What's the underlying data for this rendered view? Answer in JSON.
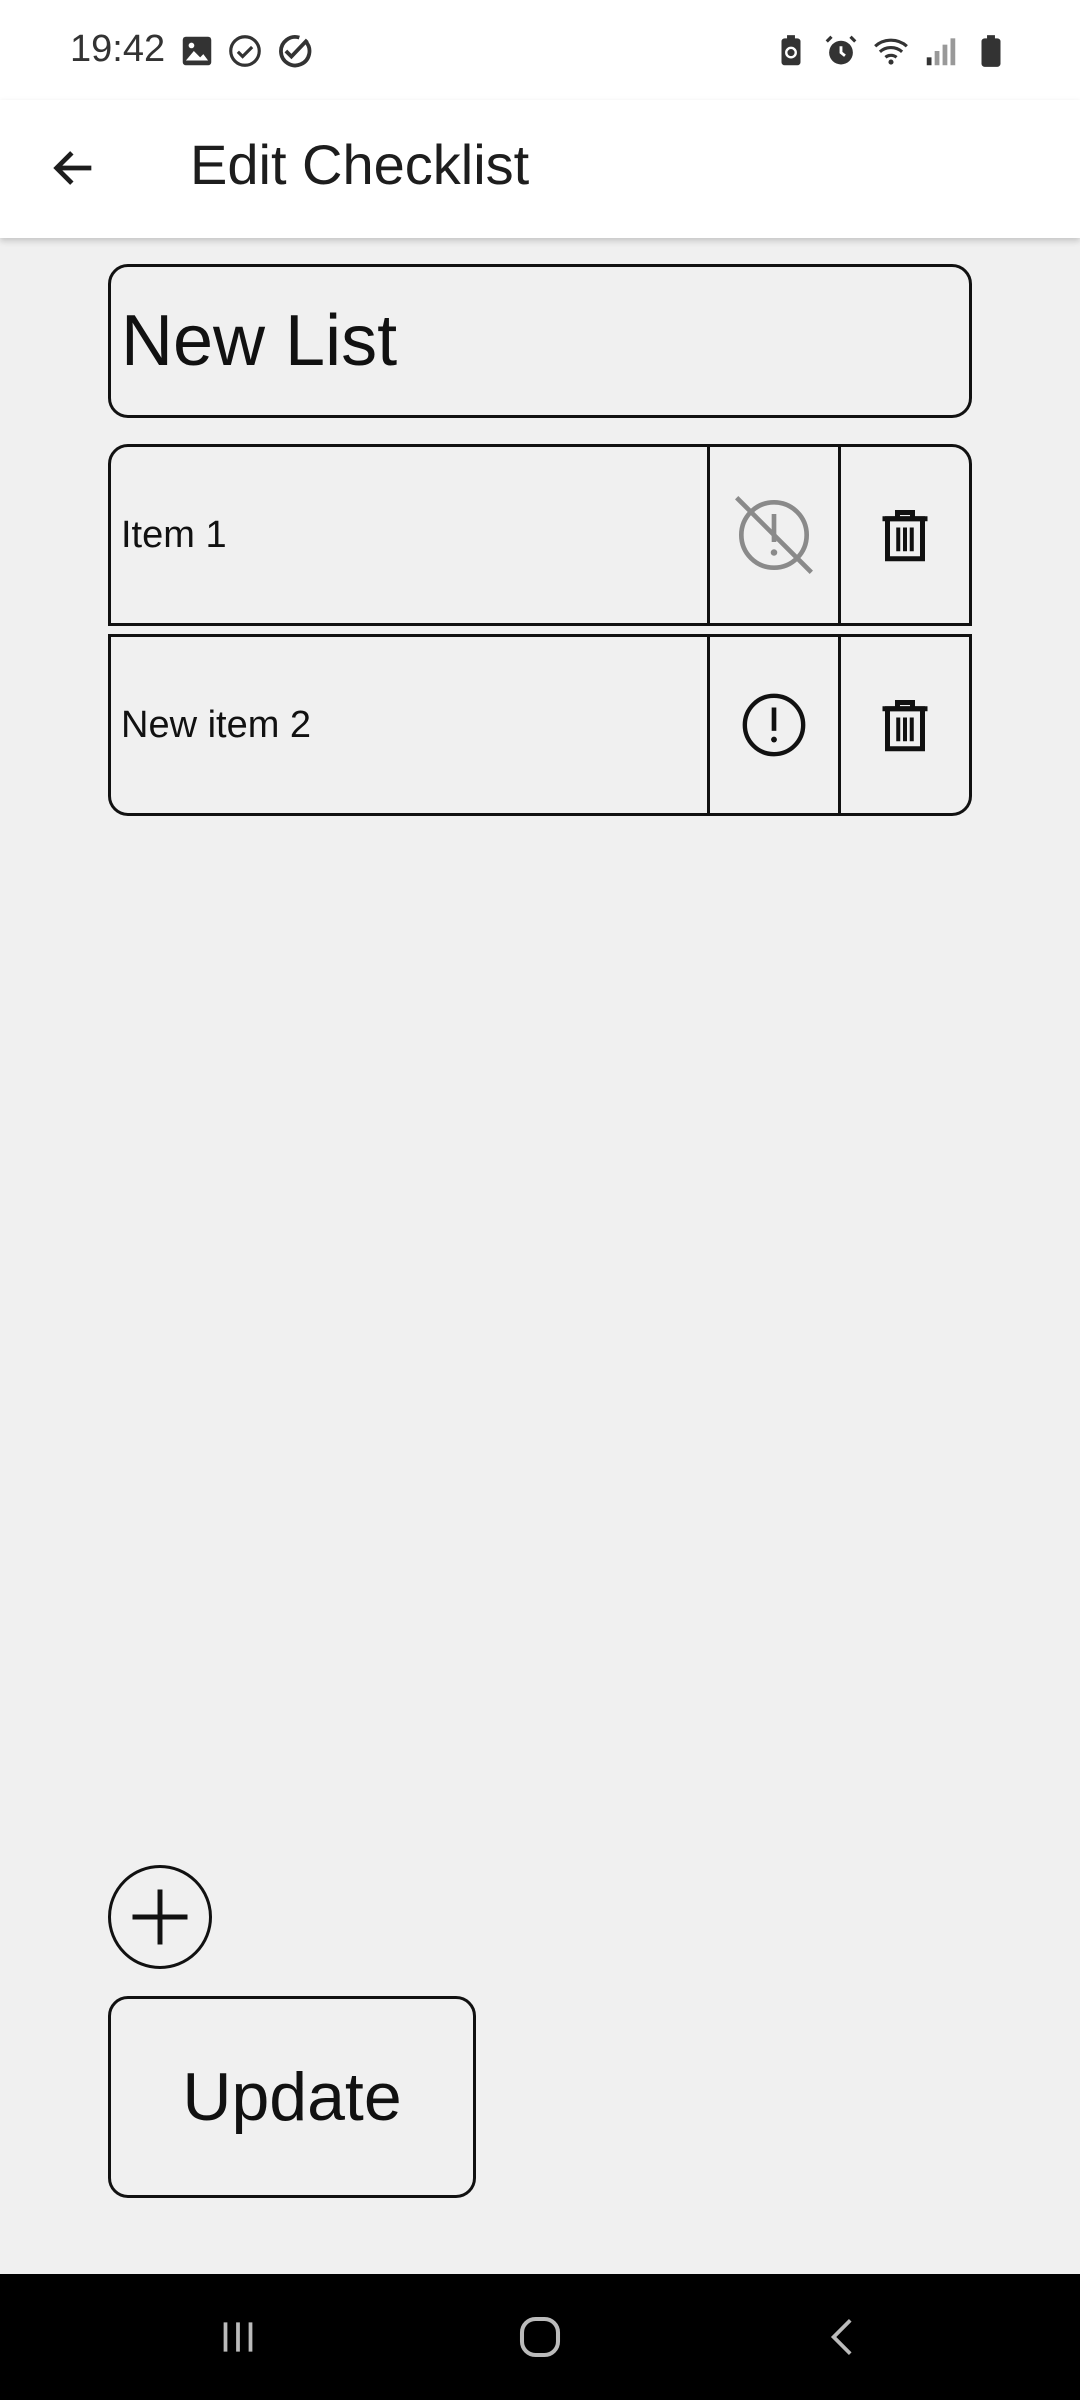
{
  "status_bar": {
    "time": "19:42",
    "left_icons": [
      "image-icon",
      "check-circle-icon",
      "check-icon"
    ],
    "right_icons": [
      "battery-saver-icon",
      "alarm-icon",
      "wifi-icon",
      "signal-icon",
      "battery-icon"
    ]
  },
  "app_bar": {
    "title": "Edit Checklist",
    "back_icon": "arrow-left-icon"
  },
  "checklist": {
    "title_value": "New List",
    "items": [
      {
        "label": "Item 1",
        "priority_icon": "priority-off-icon",
        "delete_icon": "trash-icon"
      },
      {
        "label": "New item 2",
        "priority_icon": "priority-icon",
        "delete_icon": "trash-icon"
      }
    ]
  },
  "actions": {
    "add_icon": "plus-icon",
    "update_label": "Update"
  },
  "nav_bar": {
    "icons": [
      "recent-apps-icon",
      "home-icon",
      "back-icon"
    ]
  },
  "colors": {
    "background": "#f0f0f0",
    "app_bar": "#ffffff",
    "border": "#111111",
    "muted_icon": "#8a8a8a",
    "nav_bar": "#000000"
  }
}
